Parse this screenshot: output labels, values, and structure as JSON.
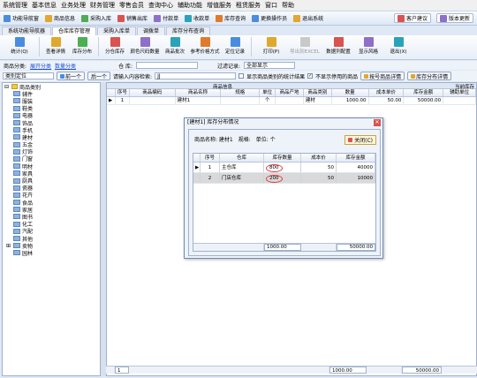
{
  "menu": [
    "系统管理",
    "基本信息",
    "业务处理",
    "财务管理",
    "零售会员",
    "查询中心",
    "辅助功能",
    "增值服务",
    "租赁服务",
    "窗口",
    "帮助"
  ],
  "quickbar": {
    "items": [
      {
        "label": "功能导航窗",
        "icon": "navigation-icon"
      },
      {
        "label": "商品信息",
        "icon": "goods-icon"
      },
      {
        "label": "采购入库",
        "icon": "purchase-icon"
      },
      {
        "label": "销售出库",
        "icon": "sales-icon"
      },
      {
        "label": "付款单",
        "icon": "payment-icon"
      },
      {
        "label": "收款单",
        "icon": "receipt-icon"
      },
      {
        "label": "库存查询",
        "icon": "stock-query-icon"
      },
      {
        "label": "更换操作员",
        "icon": "switch-user-icon"
      },
      {
        "label": "退出系统",
        "icon": "exit-icon"
      }
    ],
    "right": [
      {
        "label": "客户建议",
        "icon": "suggest-icon"
      },
      {
        "label": "版本更新",
        "icon": "update-icon"
      }
    ]
  },
  "tabs": [
    "系统功能导航器",
    "仓库库存管理",
    "采购入库单",
    "调拨单",
    "库存分布查询"
  ],
  "active_tab": 1,
  "toolbar": [
    {
      "label": "统计(Q)",
      "icon": "stats-icon"
    },
    {
      "label": "查看详情",
      "icon": "details-icon"
    },
    {
      "label": "库存分布",
      "icon": "distribution-icon"
    },
    {
      "label": "分仓库存",
      "icon": "sub-warehouse-icon"
    },
    {
      "label": "颜色尺码数量",
      "icon": "color-size-icon"
    },
    {
      "label": "商品批次",
      "icon": "batch-icon"
    },
    {
      "label": "参考价格方式",
      "icon": "price-mode-icon"
    },
    {
      "label": "定位记录",
      "icon": "locate-icon"
    },
    {
      "label": "打印(P)",
      "icon": "print-icon"
    },
    {
      "label": "导出到EXCEL",
      "icon": "excel-icon",
      "disabled": true
    },
    {
      "label": "数据列配置",
      "icon": "column-config-icon"
    },
    {
      "label": "显示风格",
      "icon": "style-icon"
    },
    {
      "label": "退出(X)",
      "icon": "exit-icon"
    }
  ],
  "filter": {
    "category_label": "商品分类:",
    "category_link1": "展开分类",
    "category_link2": "数量分类",
    "warehouse_label": "仓 库:",
    "filter_label": "过滤记录:",
    "filter_value": "全部显示"
  },
  "search": {
    "locate_label": "类别定位",
    "prev_label": "前一个",
    "next_label": "后一个",
    "query_label": "请输入内容检索:",
    "query_value": "JJ",
    "opt1": "显示商品类别的统计结果",
    "opt2": "不显示停用的商品",
    "btn1": "按号商品详情",
    "btn2": "库存分布详情"
  },
  "tree": {
    "root": "商品类别",
    "items": [
      "辅件",
      "服装",
      "鞋类",
      "电器",
      "饰品",
      "手机",
      "建材",
      "五金",
      "灯饰",
      "门窗",
      "明材",
      "家具",
      "厨具",
      "瓷器",
      "花卉",
      "食品",
      "家居",
      "图书",
      "化工",
      "汽配",
      "其他",
      "卖物",
      "园林"
    ]
  },
  "grid": {
    "group_label": "商品信息",
    "group_label2": "当前库存",
    "columns": [
      "序号",
      "商品编码",
      "商品名称",
      "规格",
      "单位",
      "商品产地",
      "商品类别",
      "数量",
      "成本单价",
      "库存金额",
      "辅助单位"
    ],
    "rows": [
      {
        "seq": "1",
        "code": "",
        "name": "建材1",
        "spec": "",
        "unit": "个",
        "origin": "",
        "category": "建材",
        "qty": "1000.00",
        "cost": "50.00",
        "amount": "50000.00",
        "aux": ""
      }
    ],
    "footer": {
      "count": "1",
      "qty": "1000.00",
      "amount": "50000.00"
    }
  },
  "dialog": {
    "title": "[建材1] 库存分布情况",
    "info_name": "商品名称: 建材1",
    "info_spec": "规格:",
    "info_unit": "单位: 个",
    "close_label": "关闭(C)",
    "columns": [
      "序号",
      "仓库",
      "库存数量",
      "成本价",
      "库存金额"
    ],
    "rows": [
      {
        "seq": "1",
        "warehouse": "主仓库",
        "qty": "800",
        "cost": "50",
        "amount": "40000"
      },
      {
        "seq": "2",
        "warehouse": "门店仓库",
        "qty": "200",
        "cost": "50",
        "amount": "10000"
      }
    ],
    "footer": {
      "qty": "1000.00",
      "amount": "50000.00"
    }
  },
  "colors": {
    "accent": "#1a4fd8",
    "highlight": "#e23b3b"
  }
}
